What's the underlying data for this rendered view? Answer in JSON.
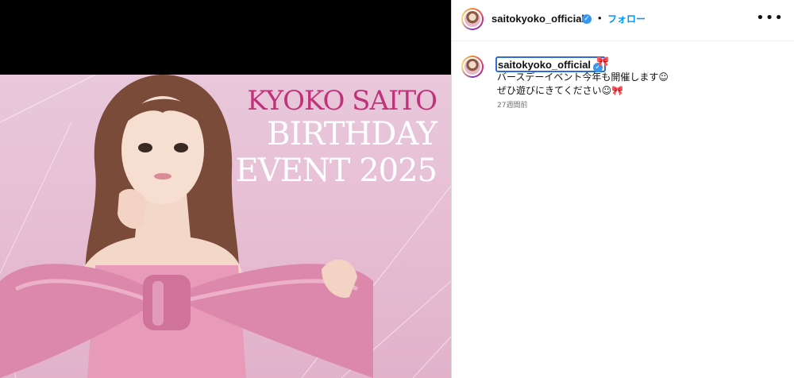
{
  "colors": {
    "link_blue": "#0095f6",
    "verified_blue": "#3897f0",
    "title_pink": "#c0337b",
    "photo_bg": "#e7bfd4"
  },
  "media": {
    "title_line1": "KYOKO SAITO",
    "title_line2": "BIRTHDAY",
    "title_line3": "EVENT 2025"
  },
  "header": {
    "username": "saitokyoko_official",
    "verified_icon": "verified-badge-icon",
    "separator": "•",
    "follow_label": "フォロー",
    "more_icon": "more-options-icon",
    "more_glyph": "•••"
  },
  "caption": {
    "username": "saitokyoko_official",
    "bow": "🎀",
    "line1": "バースデーイベント今年も開催します☺",
    "line2": "ぜひ遊びにきてください☺🎀",
    "time": "27週間前"
  }
}
